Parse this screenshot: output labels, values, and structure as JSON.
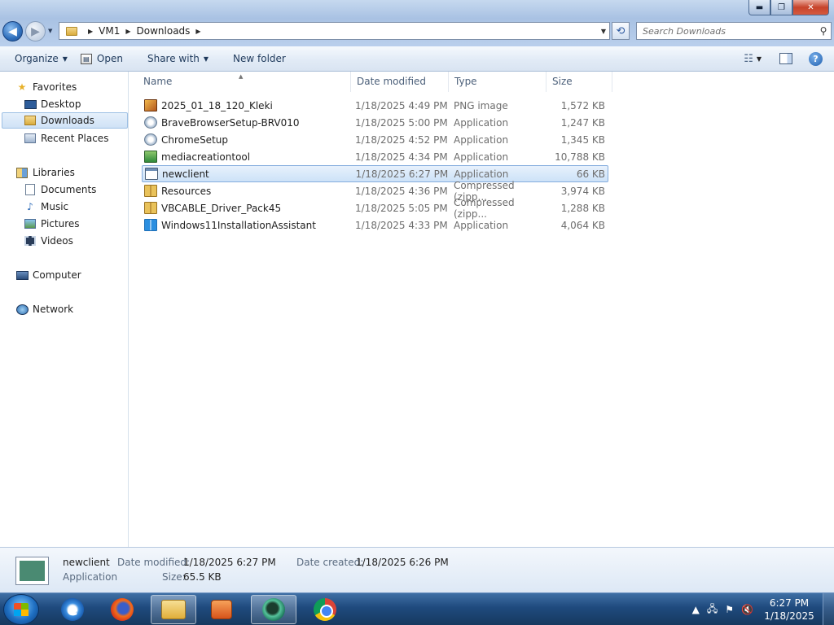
{
  "window": {
    "controls": {
      "minimize": "▬",
      "maximize": "❐",
      "close": "✕"
    }
  },
  "address": {
    "crumbs": [
      "VM1",
      "Downloads"
    ]
  },
  "search": {
    "placeholder": "Search Downloads"
  },
  "commands": {
    "organize": "Organize",
    "open": "Open",
    "share_with": "Share with",
    "new_folder": "New folder"
  },
  "nav_pane": {
    "favorites": "Favorites",
    "desktop": "Desktop",
    "downloads": "Downloads",
    "recent_places": "Recent Places",
    "libraries": "Libraries",
    "documents": "Documents",
    "music": "Music",
    "pictures": "Pictures",
    "videos": "Videos",
    "computer": "Computer",
    "network": "Network"
  },
  "columns": {
    "name": "Name",
    "date_modified": "Date modified",
    "type": "Type",
    "size": "Size"
  },
  "files": [
    {
      "name": "2025_01_18_120_Kleki",
      "date": "1/18/2025 4:49 PM",
      "type": "PNG image",
      "size": "1,572 KB",
      "icon": "png-image-icon"
    },
    {
      "name": "BraveBrowserSetup-BRV010",
      "date": "1/18/2025 5:00 PM",
      "type": "Application",
      "size": "1,247 KB",
      "icon": "installer-icon"
    },
    {
      "name": "ChromeSetup",
      "date": "1/18/2025 4:52 PM",
      "type": "Application",
      "size": "1,345 KB",
      "icon": "installer-icon"
    },
    {
      "name": "mediacreationtool",
      "date": "1/18/2025 4:34 PM",
      "type": "Application",
      "size": "10,788 KB",
      "icon": "media-tool-icon"
    },
    {
      "name": "newclient",
      "date": "1/18/2025 6:27 PM",
      "type": "Application",
      "size": "66 KB",
      "icon": "application-icon",
      "selected": true
    },
    {
      "name": "Resources",
      "date": "1/18/2025 4:36 PM",
      "type": "Compressed (zipp...",
      "size": "3,974 KB",
      "icon": "zip-folder-icon"
    },
    {
      "name": "VBCABLE_Driver_Pack45",
      "date": "1/18/2025 5:05 PM",
      "type": "Compressed (zipp...",
      "size": "1,288 KB",
      "icon": "zip-folder-icon"
    },
    {
      "name": "Windows11InstallationAssistant",
      "date": "1/18/2025 4:33 PM",
      "type": "Application",
      "size": "4,064 KB",
      "icon": "windows-logo-icon"
    }
  ],
  "details": {
    "name": "newclient",
    "kind": "Application",
    "date_modified_label": "Date modified:",
    "date_modified": "1/18/2025 6:27 PM",
    "date_created_label": "Date created:",
    "date_created": "1/18/2025 6:26 PM",
    "size_label": "Size:",
    "size": "65.5 KB"
  },
  "taskbar": {
    "ie_glyph": "e",
    "clock_time": "6:27 PM",
    "clock_date": "1/18/2025"
  }
}
